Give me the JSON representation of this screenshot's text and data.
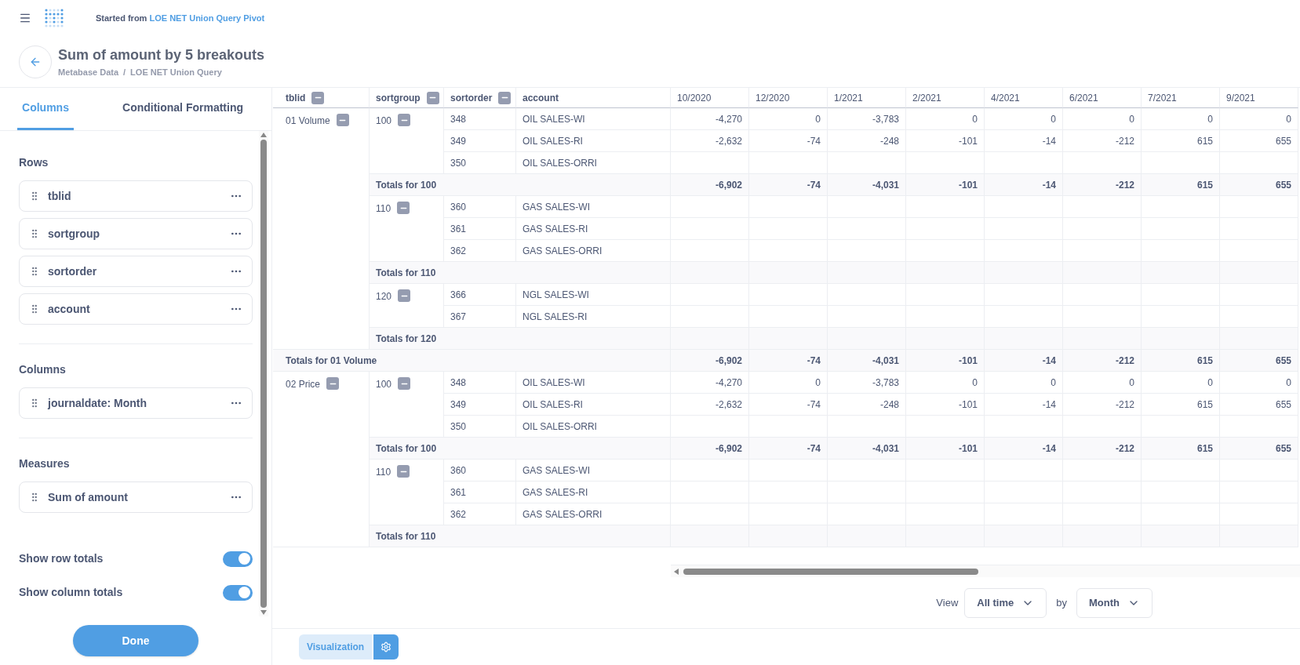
{
  "topbar": {
    "prefix": "Started from",
    "source_link": "LOE NET Union Query Pivot"
  },
  "header": {
    "title": "Sum of amount by 5 breakouts",
    "breadcrumb": [
      "Metabase Data",
      "LOE NET Union Query"
    ],
    "separator": "/"
  },
  "sidebar": {
    "tabs": [
      {
        "label": "Columns",
        "selected": true
      },
      {
        "label": "Conditional Formatting",
        "selected": false
      }
    ],
    "sections": [
      {
        "title": "Rows",
        "fields": [
          "tblid",
          "sortgroup",
          "sortorder",
          "account"
        ]
      },
      {
        "title": "Columns",
        "fields": [
          "journaldate: Month"
        ]
      },
      {
        "title": "Measures",
        "fields": [
          "Sum of amount"
        ]
      }
    ],
    "toggles": [
      {
        "label": "Show row totals",
        "on": true
      },
      {
        "label": "Show column totals",
        "on": true
      }
    ],
    "done_button": "Done"
  },
  "table": {
    "row_headers": [
      "tblid",
      "sortgroup",
      "sortorder",
      "account"
    ],
    "columns": [
      "10/2020",
      "12/2020",
      "1/2021",
      "2/2021",
      "4/2021",
      "6/2021",
      "7/2021",
      "9/2021"
    ],
    "groups": [
      {
        "label": "01 Volume",
        "subgroups": [
          {
            "label": "100",
            "rows": [
              {
                "sortorder": "348",
                "account": "OIL SALES-WI",
                "values": [
                  "-4,270",
                  "0",
                  "-3,783",
                  "0",
                  "0",
                  "0",
                  "0",
                  "0"
                ]
              },
              {
                "sortorder": "349",
                "account": "OIL SALES-RI",
                "values": [
                  "-2,632",
                  "-74",
                  "-248",
                  "-101",
                  "-14",
                  "-212",
                  "615",
                  "655"
                ]
              },
              {
                "sortorder": "350",
                "account": "OIL SALES-ORRI"
              }
            ],
            "total_label": "Totals for 100",
            "total_values": [
              "-6,902",
              "-74",
              "-4,031",
              "-101",
              "-14",
              "-212",
              "615",
              "655"
            ]
          },
          {
            "label": "110",
            "rows": [
              {
                "sortorder": "360",
                "account": "GAS SALES-WI"
              },
              {
                "sortorder": "361",
                "account": "GAS SALES-RI"
              },
              {
                "sortorder": "362",
                "account": "GAS SALES-ORRI"
              }
            ],
            "total_label": "Totals for 110"
          },
          {
            "label": "120",
            "rows": [
              {
                "sortorder": "366",
                "account": "NGL SALES-WI"
              },
              {
                "sortorder": "367",
                "account": "NGL SALES-RI"
              }
            ],
            "total_label": "Totals for 120"
          }
        ],
        "total_label": "Totals for 01 Volume",
        "total_values": [
          "-6,902",
          "-74",
          "-4,031",
          "-101",
          "-14",
          "-212",
          "615",
          "655"
        ]
      },
      {
        "label": "02 Price",
        "subgroups": [
          {
            "label": "100",
            "rows": [
              {
                "sortorder": "348",
                "account": "OIL SALES-WI",
                "values": [
                  "-4,270",
                  "0",
                  "-3,783",
                  "0",
                  "0",
                  "0",
                  "0",
                  "0"
                ]
              },
              {
                "sortorder": "349",
                "account": "OIL SALES-RI",
                "values": [
                  "-2,632",
                  "-74",
                  "-248",
                  "-101",
                  "-14",
                  "-212",
                  "615",
                  "655"
                ]
              },
              {
                "sortorder": "350",
                "account": "OIL SALES-ORRI"
              }
            ],
            "total_label": "Totals for 100",
            "total_values": [
              "-6,902",
              "-74",
              "-4,031",
              "-101",
              "-14",
              "-212",
              "615",
              "655"
            ]
          },
          {
            "label": "110",
            "rows": [
              {
                "sortorder": "360",
                "account": "GAS SALES-WI"
              },
              {
                "sortorder": "361",
                "account": "GAS SALES-RI"
              },
              {
                "sortorder": "362",
                "account": "GAS SALES-ORRI"
              }
            ],
            "total_label": "Totals for 110"
          }
        ]
      }
    ]
  },
  "time_controls": {
    "view_label": "View",
    "range": "All time",
    "by_label": "by",
    "unit": "Month"
  },
  "footer": {
    "visualization_button": "Visualization"
  }
}
